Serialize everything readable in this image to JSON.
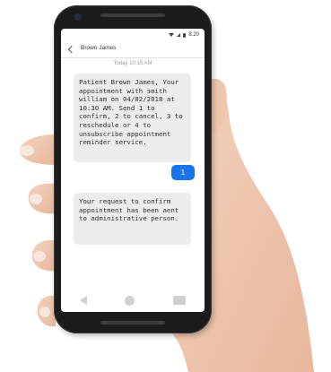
{
  "status_bar": {
    "time": "8:20"
  },
  "conversation": {
    "contact_name": "Brown James",
    "timestamp": "Today 10:15 AM"
  },
  "messages": [
    {
      "direction": "incoming",
      "text": "Patient Brown James, Your\nappointment with smith\nwilliam on 04/02/2018 at\n10:30 AM. Send 1 to\nconfirm, 2 to cancel, 3 to\nreschedule or 4 to\nunsubscribe appointment\nreminder service."
    },
    {
      "direction": "outgoing",
      "text": "1"
    },
    {
      "direction": "incoming",
      "text": "Your request to confirm\nappointment has been aent\nto administrative person."
    }
  ],
  "colors": {
    "outgoing_bubble": "#1a73e8",
    "incoming_bubble": "#ececec",
    "phone_body": "#1c1c1e"
  },
  "icons": [
    "back-arrow-icon",
    "wifi-icon",
    "signal-icon",
    "battery-icon",
    "nav-back-icon",
    "nav-home-icon",
    "nav-recents-icon"
  ]
}
